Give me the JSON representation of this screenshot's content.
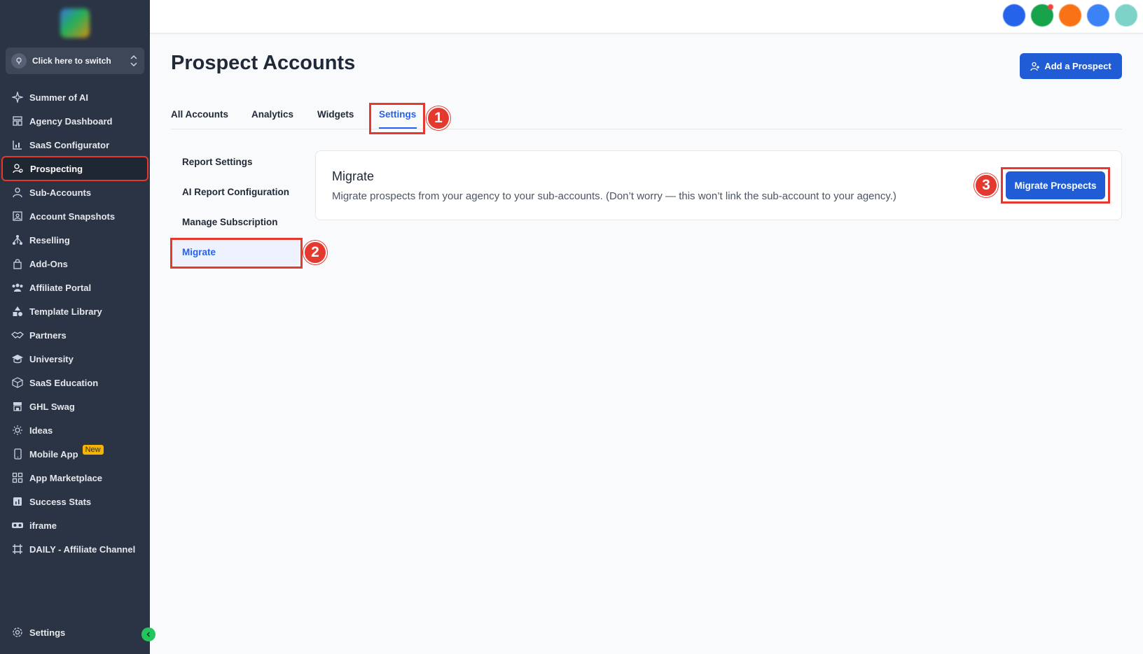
{
  "sidebar": {
    "switcher_label": "Click here to switch",
    "items": [
      {
        "label": "Summer of AI",
        "icon": "sparkle-icon"
      },
      {
        "label": "Agency Dashboard",
        "icon": "dashboard-icon"
      },
      {
        "label": "SaaS Configurator",
        "icon": "chart-icon"
      },
      {
        "label": "Prospecting",
        "icon": "user-search-icon",
        "active": true
      },
      {
        "label": "Sub-Accounts",
        "icon": "user-icon"
      },
      {
        "label": "Account Snapshots",
        "icon": "snapshot-icon"
      },
      {
        "label": "Reselling",
        "icon": "network-icon"
      },
      {
        "label": "Add-Ons",
        "icon": "bag-icon"
      },
      {
        "label": "Affiliate Portal",
        "icon": "users-icon"
      },
      {
        "label": "Template Library",
        "icon": "shapes-icon"
      },
      {
        "label": "Partners",
        "icon": "handshake-icon"
      },
      {
        "label": "University",
        "icon": "graduation-cap-icon"
      },
      {
        "label": "SaaS Education",
        "icon": "cube-icon"
      },
      {
        "label": "GHL Swag",
        "icon": "store-icon"
      },
      {
        "label": "Ideas",
        "icon": "lightbulb-icon"
      },
      {
        "label": "Mobile App",
        "icon": "mobile-icon",
        "badge": "New"
      },
      {
        "label": "App Marketplace",
        "icon": "grid-icon"
      },
      {
        "label": "Success Stats",
        "icon": "stats-icon"
      },
      {
        "label": "iframe",
        "icon": "vr-icon"
      },
      {
        "label": "DAILY - Affiliate Channel",
        "icon": "frame-icon"
      }
    ],
    "settings_label": "Settings"
  },
  "header": {
    "avatar_colors": [
      "#2563eb",
      "#16a34a",
      "#f97316",
      "#3b82f6",
      "#7dd3c8"
    ]
  },
  "main": {
    "title": "Prospect Accounts",
    "add_button_label": "Add a Prospect",
    "tabs": [
      "All Accounts",
      "Analytics",
      "Widgets",
      "Settings"
    ],
    "active_tab": "Settings",
    "settings_nav": [
      "Report Settings",
      "AI Report Configuration",
      "Manage Subscription",
      "Migrate"
    ],
    "active_settings_nav": "Migrate",
    "card": {
      "title": "Migrate",
      "description": "Migrate prospects from your agency to your sub-accounts. (Don’t worry — this won’t link the sub-account to your agency.)",
      "button_label": "Migrate Prospects"
    }
  },
  "annotations": [
    "1",
    "2",
    "3"
  ],
  "colors": {
    "sidebar_bg": "#2a3444",
    "accent": "#1f5cd6",
    "annotation": "#e5382e"
  }
}
